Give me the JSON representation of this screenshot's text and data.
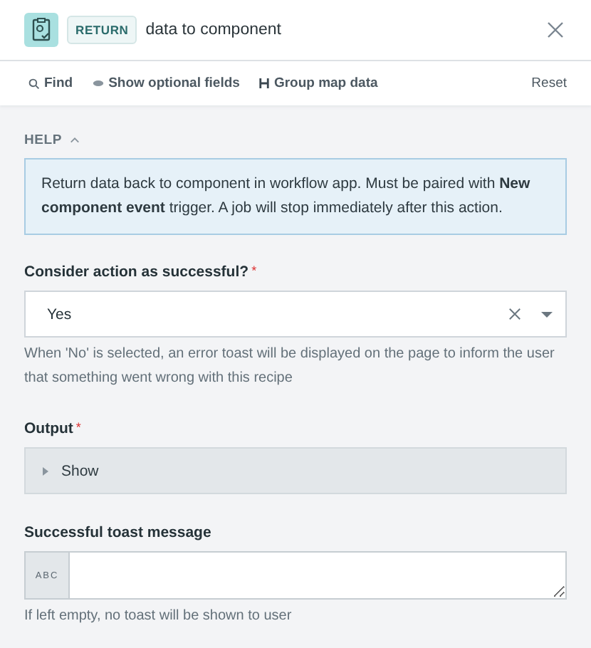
{
  "header": {
    "badge": "RETURN",
    "title": "data to component"
  },
  "toolbar": {
    "actions": [
      {
        "kind": "find",
        "label": "Find"
      },
      {
        "kind": "optional",
        "label": "Show optional fields"
      },
      {
        "kind": "group",
        "label": "Group map data"
      }
    ],
    "reset": "Reset"
  },
  "help": {
    "label": "HELP",
    "expanded": true,
    "text": "Return data back to component in workflow app. Must be paired with **New component event** trigger. A job will stop immediately after this action."
  },
  "fields": [
    {
      "kind": "select",
      "label": "Consider action as successful?",
      "required_mark": "*",
      "value": "Yes",
      "hint": "When 'No' is selected, an error toast will be displayed on the page to inform the user that something went wrong with this recipe"
    },
    {
      "kind": "collapsible",
      "label": "Output",
      "required_mark": "*",
      "toggle": "Show",
      "expanded": false
    },
    {
      "kind": "text",
      "label": "Successful toast message",
      "type_tag": "ABC",
      "hint": "If left empty, no toast will be shown to user"
    }
  ]
}
